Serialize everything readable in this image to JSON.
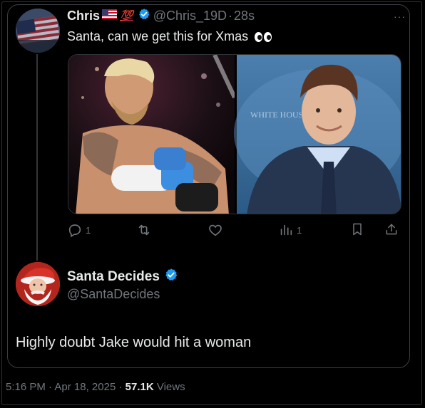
{
  "tweet": {
    "author_name": "Chris",
    "hundred_emoji": "💯",
    "handle": "@Chris_19D",
    "separator": "·",
    "time_ago": "28s",
    "text": "Santa, can we get this for Xmas",
    "more_label": "···",
    "actions": {
      "replies": "1",
      "views": "1"
    }
  },
  "reply": {
    "author_name": "Santa Decides",
    "handle": "@SantaDecides",
    "text": "Highly doubt Jake would hit a woman"
  },
  "footer": {
    "time": "5:16 PM",
    "separator": "·",
    "date": "Apr 18, 2025",
    "views_count": "57.1K",
    "views_label": "Views"
  },
  "colors": {
    "background": "#000000",
    "text": "#e7e9ea",
    "muted": "#71767b",
    "verified": "#1d9bf0"
  },
  "icons": [
    "american-flag-icon",
    "hundred-points-icon",
    "verified-badge-icon",
    "eyes-icon",
    "reply-icon",
    "retweet-icon",
    "like-icon",
    "views-icon",
    "bookmark-icon",
    "share-icon"
  ]
}
